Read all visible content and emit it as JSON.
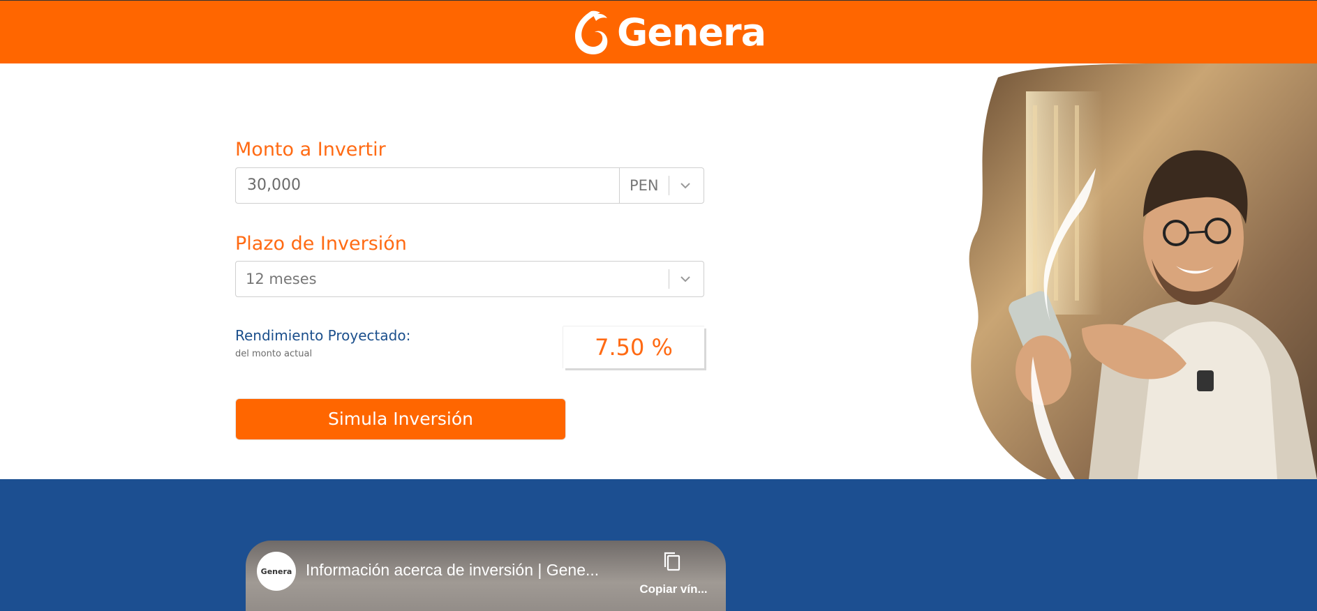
{
  "brand": {
    "name": "Genera",
    "colors": {
      "primary": "#ff6600",
      "secondary": "#1c4f91"
    }
  },
  "form": {
    "amount_label": "Monto a Invertir",
    "amount_value": "30,000",
    "currency_value": "PEN",
    "term_label": "Plazo de Inversión",
    "term_value": "12 meses",
    "yield_label": "Rendimiento Proyectado:",
    "yield_sublabel": "del monto actual",
    "yield_value": "7.50 %",
    "submit_label": "Simula Inversión"
  },
  "video": {
    "channel_logo_text": "Genera",
    "title": "Información acerca de inversión | Gene...",
    "copy_link_label": "Copiar vín..."
  },
  "icons": [
    "genera-logo-icon",
    "chevron-down-icon",
    "copy-link-icon"
  ]
}
